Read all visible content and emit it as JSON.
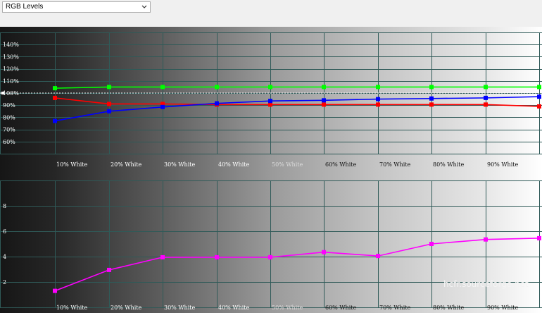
{
  "toolbar": {
    "view_select": "RGB Levels"
  },
  "watermark": "hcfr.sourceforge.net",
  "chart_data": [
    {
      "type": "line",
      "categories": [
        "",
        "10% White",
        "20% White",
        "30% White",
        "40% White",
        "50% White",
        "60% White",
        "70% White",
        "80% White",
        "90% White",
        ""
      ],
      "y_ticks": [
        "60%",
        "70%",
        "80%",
        "90%",
        "100%",
        "110%",
        "120%",
        "130%",
        "140%"
      ],
      "ylim": [
        50,
        150
      ],
      "reference": 100,
      "series": [
        {
          "color": "#00ff00",
          "values": [
            null,
            104,
            105,
            105,
            105,
            105,
            105,
            105,
            105,
            105,
            105
          ]
        },
        {
          "color": "#ff0000",
          "values": [
            null,
            96,
            91,
            91,
            90.5,
            90.5,
            90.5,
            90.5,
            90.5,
            90.5,
            89
          ]
        },
        {
          "color": "#0000ff",
          "values": [
            null,
            77,
            85,
            88.5,
            91.5,
            93.5,
            94,
            95,
            95.5,
            96,
            97
          ]
        }
      ]
    },
    {
      "type": "line",
      "categories": [
        "",
        "10% White",
        "20% White",
        "30% White",
        "40% White",
        "50% White",
        "60% White",
        "70% White",
        "80% White",
        "90% White",
        ""
      ],
      "y_ticks": [
        "2",
        "4",
        "6",
        "8"
      ],
      "ylim": [
        0,
        10
      ],
      "series": [
        {
          "color": "#ff00ff",
          "values": [
            null,
            1.3,
            2.95,
            3.95,
            3.95,
            3.95,
            4.35,
            4.05,
            5.0,
            5.35,
            5.45
          ]
        }
      ]
    }
  ]
}
